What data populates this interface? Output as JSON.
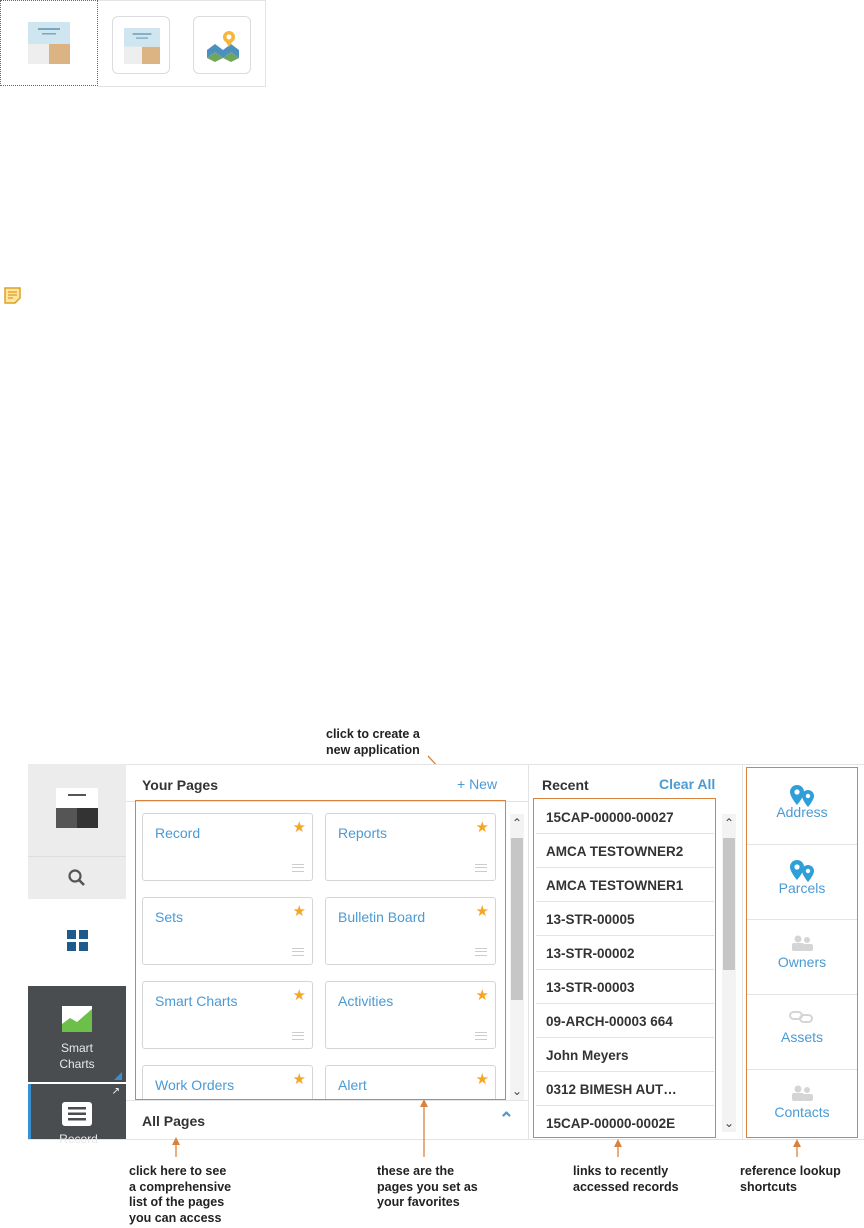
{
  "annotations": {
    "new_app": [
      "click to create a",
      "new application"
    ],
    "all_pages": [
      "click here to see",
      "a comprehensive",
      "list of the pages",
      "you can access"
    ],
    "favorites": [
      "these are the",
      "pages you set as",
      "your favorites"
    ],
    "recent": [
      "links to recently",
      "accessed records"
    ],
    "lookup": [
      "reference lookup",
      "shortcuts"
    ]
  },
  "left_nav": {
    "smart_charts_label": [
      "Smart",
      "Charts"
    ],
    "record_label": "Record"
  },
  "your_pages": {
    "title": "Your Pages",
    "new_label": "+ New",
    "cards": [
      {
        "label": "Record"
      },
      {
        "label": "Reports"
      },
      {
        "label": "Sets"
      },
      {
        "label": "Bulletin Board"
      },
      {
        "label": "Smart Charts"
      },
      {
        "label": "Activities"
      },
      {
        "label": "Work Orders"
      },
      {
        "label": "Alert"
      }
    ],
    "all_pages_label": "All Pages"
  },
  "recent": {
    "title": "Recent",
    "clear_label": "Clear All",
    "items": [
      "15CAP-00000-00027",
      "AMCA TESTOWNER2",
      "AMCA TESTOWNER1",
      "13-STR-00005",
      "13-STR-00002",
      "13-STR-00003",
      "09-ARCH-00003 664",
      "John Meyers",
      "0312 BIMESH AUT…",
      "15CAP-00000-0002E"
    ]
  },
  "shortcuts": [
    {
      "label": "Address",
      "icon": "map-pin-icon"
    },
    {
      "label": "Parcels",
      "icon": "map-pin-icon"
    },
    {
      "label": "Owners",
      "icon": "people-icon"
    },
    {
      "label": "Assets",
      "icon": "link-icon"
    },
    {
      "label": "Contacts",
      "icon": "people-icon"
    }
  ],
  "colors": {
    "link": "#4a9ad4",
    "star": "#f5a623",
    "annotation_box": "#d9823d"
  }
}
